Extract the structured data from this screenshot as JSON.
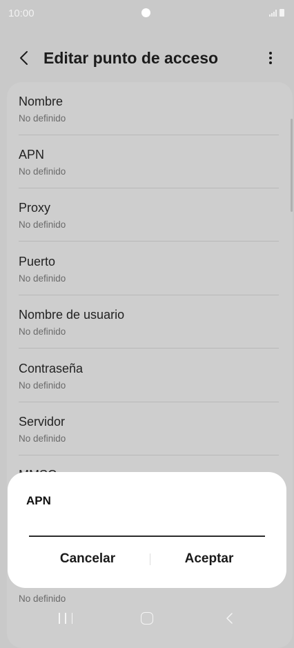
{
  "status_bar": {
    "time": "10:00"
  },
  "app_bar": {
    "title": "Editar punto de acceso"
  },
  "settings_items": [
    {
      "label": "Nombre",
      "value": "No definido"
    },
    {
      "label": "APN",
      "value": "No definido"
    },
    {
      "label": "Proxy",
      "value": "No definido"
    },
    {
      "label": "Puerto",
      "value": "No definido"
    },
    {
      "label": "Nombre de usuario",
      "value": "No definido"
    },
    {
      "label": "Contraseña",
      "value": "No definido"
    },
    {
      "label": "Servidor",
      "value": "No definido"
    },
    {
      "label": "MMSC",
      "value": "No definido"
    }
  ],
  "dialog": {
    "title": "APN",
    "input_value": "",
    "cancel_label": "Cancelar",
    "accept_label": "Aceptar"
  },
  "colors": {
    "dimmed_background": "#c9c9c9",
    "dialog_background": "#ffffff",
    "text_primary": "#1b1b1b",
    "text_secondary": "#6a6a6a"
  },
  "icons": {
    "back": "chevron-left-icon",
    "more": "more-vertical-icon",
    "nav_recents": "recents-icon",
    "nav_home": "home-icon",
    "nav_back": "back-arrow-icon"
  }
}
